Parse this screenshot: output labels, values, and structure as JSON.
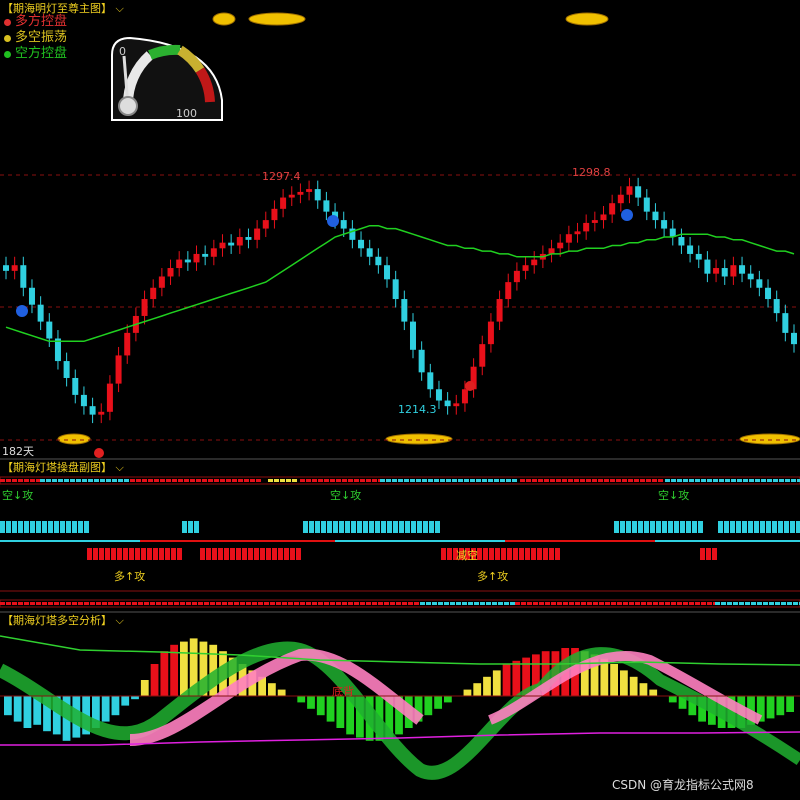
{
  "panels": {
    "main_title": "【期海明灯至尊主图】",
    "sub_title": "【期海灯塔操盘副图】",
    "osc_title": "【期海灯塔多空分析】"
  },
  "legend": [
    {
      "label": "多方控盘",
      "color": "#e03030"
    },
    {
      "label": "多空振荡",
      "color": "#d8c020"
    },
    {
      "label": "空方控盘",
      "color": "#20c020"
    }
  ],
  "gauge": {
    "min_label": "0",
    "max_label": "100",
    "value": 0.1
  },
  "annotations": {
    "high1": "1297.4",
    "high2": "1298.8",
    "low1": "1214.3",
    "days": "182天",
    "short_attack": "空↓攻",
    "long_attack": "多↑攻",
    "reduce_short": "减空",
    "bottom_div": "底背",
    "watermark": "CSDN @育龙指标公式网8"
  },
  "colors": {
    "up": "#e8101a",
    "down": "#30d0e0",
    "ma": "#20d020",
    "grid": "#8a1010",
    "title": "#f0d020",
    "magenta": "#e020e0",
    "pink": "#ff7fc0",
    "yellow": "#f0e040"
  },
  "chart_data": [
    {
      "type": "candlestick",
      "title": "【期海明灯至尊主图】",
      "annotations": [
        "1297.4",
        "1298.8",
        "1214.3"
      ],
      "close": [
        1268,
        1270,
        1262,
        1256,
        1250,
        1244,
        1236,
        1230,
        1224,
        1220,
        1217,
        1218,
        1228,
        1238,
        1246,
        1252,
        1258,
        1262,
        1266,
        1269,
        1272,
        1271,
        1274,
        1273,
        1276,
        1278,
        1277,
        1280,
        1279,
        1283,
        1286,
        1290,
        1294,
        1295,
        1296,
        1297,
        1293,
        1289,
        1286,
        1283,
        1279,
        1276,
        1273,
        1270,
        1265,
        1258,
        1250,
        1240,
        1232,
        1226,
        1222,
        1220,
        1221,
        1226,
        1234,
        1242,
        1250,
        1258,
        1264,
        1268,
        1270,
        1272,
        1274,
        1276,
        1278,
        1281,
        1282,
        1285,
        1286,
        1288,
        1292,
        1295,
        1298,
        1294,
        1289,
        1286,
        1283,
        1280,
        1277,
        1274,
        1272,
        1267,
        1269,
        1266,
        1270,
        1267,
        1265,
        1262,
        1258,
        1253,
        1246,
        1242
      ],
      "ma": [
        1248,
        1247,
        1246,
        1245,
        1244,
        1243,
        1243,
        1243,
        1243,
        1243,
        1244,
        1245,
        1246,
        1247,
        1248,
        1249,
        1250,
        1251,
        1252,
        1253,
        1254,
        1255,
        1256,
        1257,
        1258,
        1259,
        1260,
        1261,
        1262,
        1263,
        1264,
        1266,
        1268,
        1270,
        1272,
        1274,
        1276,
        1278,
        1280,
        1281,
        1282,
        1283,
        1284,
        1284,
        1283,
        1283,
        1282,
        1281,
        1280,
        1279,
        1278,
        1277,
        1277,
        1276,
        1276,
        1275,
        1275,
        1274,
        1274,
        1273,
        1273,
        1273,
        1273,
        1274,
        1274,
        1275,
        1275,
        1276,
        1276,
        1276,
        1277,
        1277,
        1278,
        1278,
        1279,
        1279,
        1280,
        1280,
        1281,
        1281,
        1281,
        1281,
        1280,
        1280,
        1279,
        1279,
        1278,
        1277,
        1276,
        1275,
        1275,
        1274
      ]
    },
    {
      "type": "bar",
      "title": "【期海灯塔多空分析】",
      "values": [
        -6,
        -8,
        -10,
        -9,
        -11,
        -12,
        -14,
        -13,
        -12,
        -10,
        -8,
        -6,
        -3,
        -1,
        5,
        10,
        14,
        16,
        17,
        18,
        17,
        16,
        14,
        12,
        10,
        8,
        6,
        4,
        2,
        0,
        -2,
        -4,
        -6,
        -8,
        -10,
        -12,
        -13,
        -14,
        -14,
        -13,
        -12,
        -10,
        -8,
        -6,
        -4,
        -2,
        0,
        2,
        4,
        6,
        8,
        10,
        11,
        12,
        13,
        14,
        14,
        15,
        15,
        14,
        13,
        12,
        10,
        8,
        6,
        4,
        2,
        0,
        -2,
        -4,
        -6,
        -8,
        -9,
        -10,
        -10,
        -10,
        -9,
        -8,
        -7,
        -6,
        -5
      ]
    }
  ]
}
